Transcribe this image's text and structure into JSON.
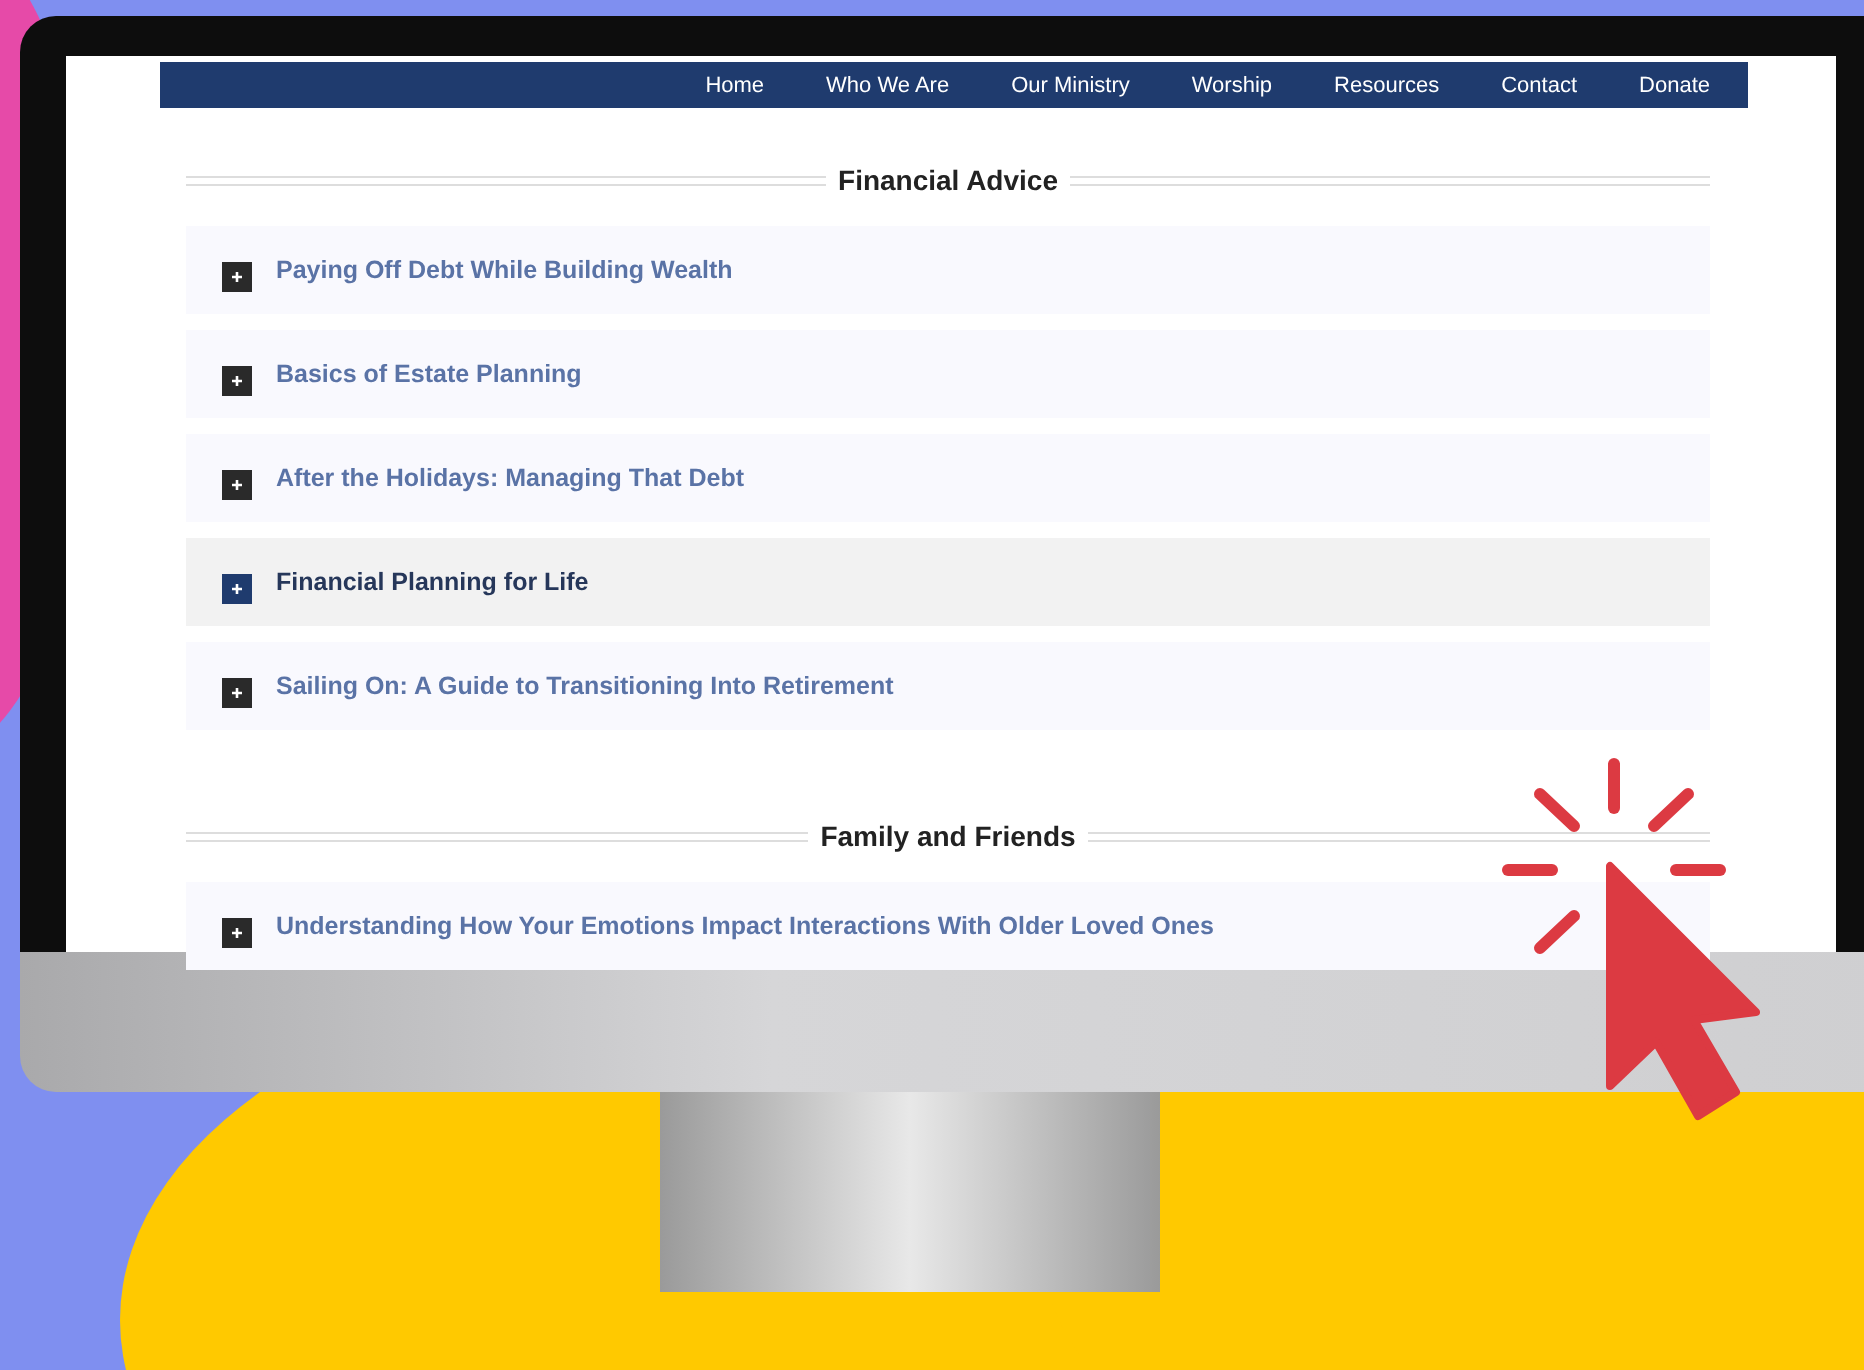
{
  "nav": {
    "items": [
      {
        "label": "Home"
      },
      {
        "label": "Who We Are"
      },
      {
        "label": "Our Ministry"
      },
      {
        "label": "Worship"
      },
      {
        "label": "Resources"
      },
      {
        "label": "Contact"
      },
      {
        "label": "Donate"
      }
    ]
  },
  "sections": [
    {
      "title": "Financial Advice",
      "items": [
        {
          "label": "Paying Off Debt While Building Wealth",
          "selected": false
        },
        {
          "label": "Basics of Estate Planning",
          "selected": false
        },
        {
          "label": "After the Holidays: Managing That Debt",
          "selected": false
        },
        {
          "label": "Financial Planning for Life",
          "selected": true
        },
        {
          "label": "Sailing On: A Guide to Transitioning Into Retirement",
          "selected": false
        }
      ]
    },
    {
      "title": "Family and Friends",
      "items": [
        {
          "label": "Understanding How Your Emotions Impact Interactions With Older Loved Ones",
          "selected": false
        }
      ]
    }
  ]
}
